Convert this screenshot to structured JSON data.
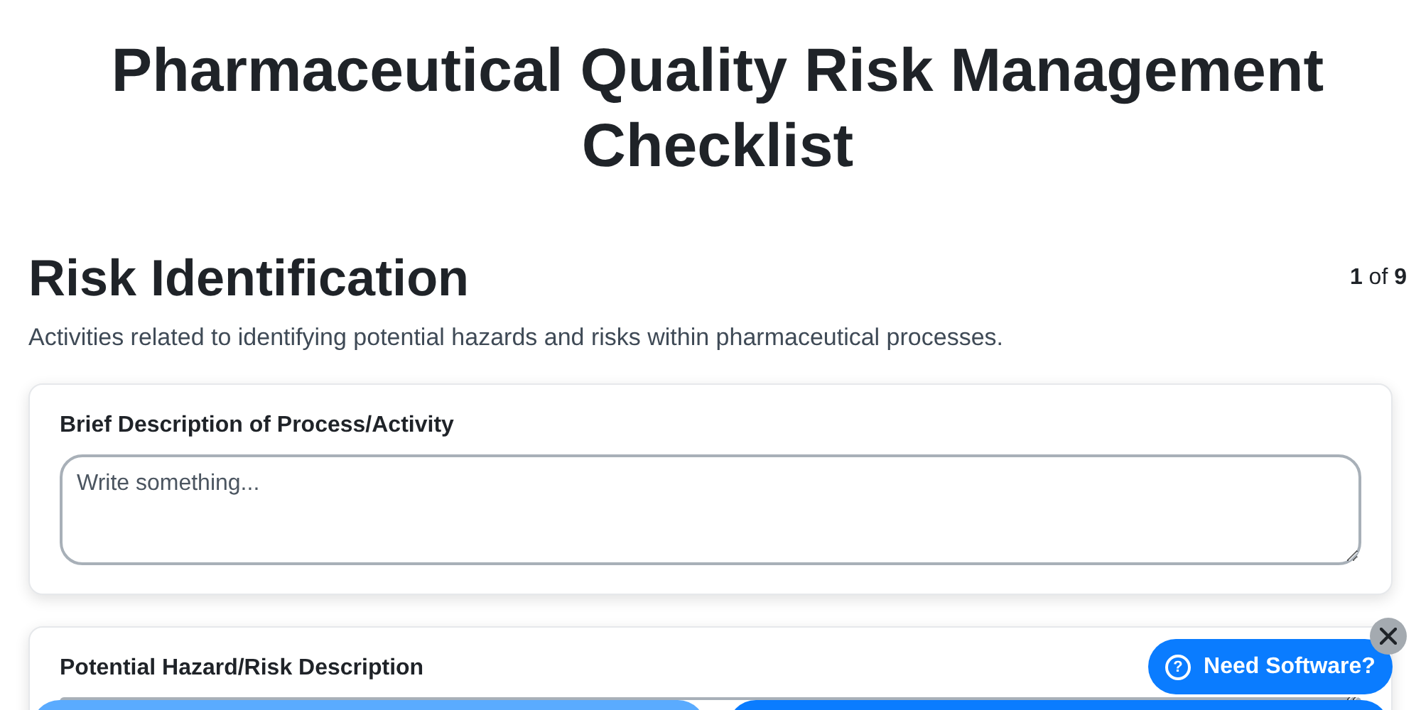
{
  "title": "Pharmaceutical Quality Risk Management Checklist",
  "section": {
    "heading": "Risk Identification",
    "counter": "**1** of **9**",
    "description": "Activities related to identifying potential hazards and risks within pharmaceutical processes."
  },
  "questions": [
    {
      "label": "Brief Description of Process/Activity",
      "placeholder": "Write something..."
    },
    {
      "label": "Potential Hazard/Risk Description"
    }
  ],
  "help_button": {
    "label": "Need Software?",
    "icon": "?"
  },
  "footer_buttons": [
    {
      "color": "#5aabff"
    },
    {
      "color": "#0a7cff"
    }
  ]
}
